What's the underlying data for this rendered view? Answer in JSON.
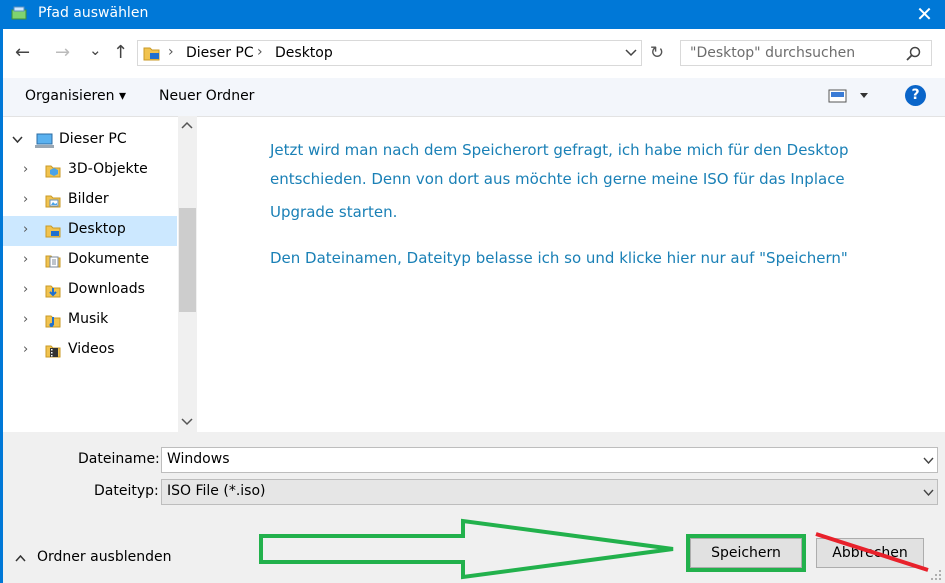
{
  "window": {
    "title": "Pfad auswählen",
    "close_glyph": "✕"
  },
  "nav": {
    "back_glyph": "←",
    "forward_glyph": "→",
    "recent_glyph": "⌄",
    "up_glyph": "↑",
    "breadcrumb": [
      "Dieser PC",
      "Desktop"
    ],
    "separator": "›",
    "refresh_glyph": "↻",
    "search_placeholder": "\"Desktop\" durchsuchen",
    "search_icon": "search-icon"
  },
  "toolbar": {
    "organize_label": "Organisieren ▾",
    "new_folder_label": "Neuer Ordner",
    "help_glyph": "?"
  },
  "tree": {
    "root": "Dieser PC",
    "items": [
      {
        "label": "3D-Objekte",
        "icon": "3d-objects-icon"
      },
      {
        "label": "Bilder",
        "icon": "pictures-icon"
      },
      {
        "label": "Desktop",
        "icon": "desktop-folder-icon"
      },
      {
        "label": "Dokumente",
        "icon": "documents-icon"
      },
      {
        "label": "Downloads",
        "icon": "downloads-icon"
      },
      {
        "label": "Musik",
        "icon": "music-icon"
      },
      {
        "label": "Videos",
        "icon": "videos-icon"
      }
    ],
    "selected": "Desktop"
  },
  "annotation": {
    "line1": "Jetzt wird man nach dem Speicherort gefragt, ich habe mich für den Desktop",
    "line2": "entschieden. Denn von dort aus möchte ich gerne meine ISO für das Inplace",
    "line3": "Upgrade starten.",
    "line4": "Den Dateinamen, Dateityp belasse ich so und klicke hier nur auf \"Speichern\""
  },
  "form": {
    "filename_label": "Dateiname:",
    "filename_value": "Windows",
    "filetype_label": "Dateityp:",
    "filetype_value": "ISO File (*.iso)"
  },
  "footer": {
    "hide_folders_label": "Ordner ausblenden",
    "save_label": "Speichern",
    "cancel_label": "Abbrechen"
  },
  "colors": {
    "accent": "#0078d7",
    "annotation_text": "#1a80b6",
    "highlight_green": "#22b14c",
    "strike_red": "#e8212b"
  }
}
